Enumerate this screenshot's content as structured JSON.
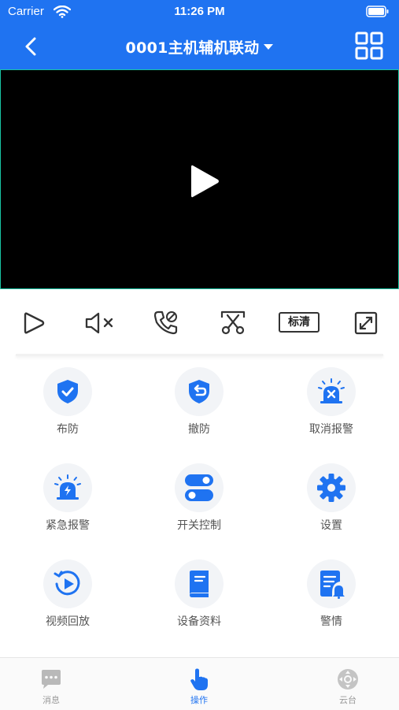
{
  "status_bar": {
    "carrier": "Carrier",
    "time": "11:26 PM"
  },
  "nav": {
    "title": "0001主机辅机联动"
  },
  "controls": {
    "quality_label": "标清"
  },
  "actions": [
    {
      "label": "布防",
      "icon": "shield-check-icon"
    },
    {
      "label": "撤防",
      "icon": "shield-undo-icon"
    },
    {
      "label": "取消报警",
      "icon": "siren-cancel-icon"
    },
    {
      "label": "紧急报警",
      "icon": "siren-emergency-icon"
    },
    {
      "label": "开关控制",
      "icon": "toggle-switch-icon"
    },
    {
      "label": "设置",
      "icon": "gear-icon"
    },
    {
      "label": "视频回放",
      "icon": "video-replay-icon"
    },
    {
      "label": "设备资料",
      "icon": "book-icon"
    },
    {
      "label": "警情",
      "icon": "alarm-report-icon"
    }
  ],
  "tabs": [
    {
      "label": "消息",
      "icon": "message-icon"
    },
    {
      "label": "操作",
      "icon": "hand-pointer-icon"
    },
    {
      "label": "云台",
      "icon": "ptz-icon"
    }
  ],
  "colors": {
    "primary": "#1f73f1",
    "video_border": "#19c5a5",
    "icon_bg": "#f2f4f7",
    "inactive_tab": "#999999"
  }
}
